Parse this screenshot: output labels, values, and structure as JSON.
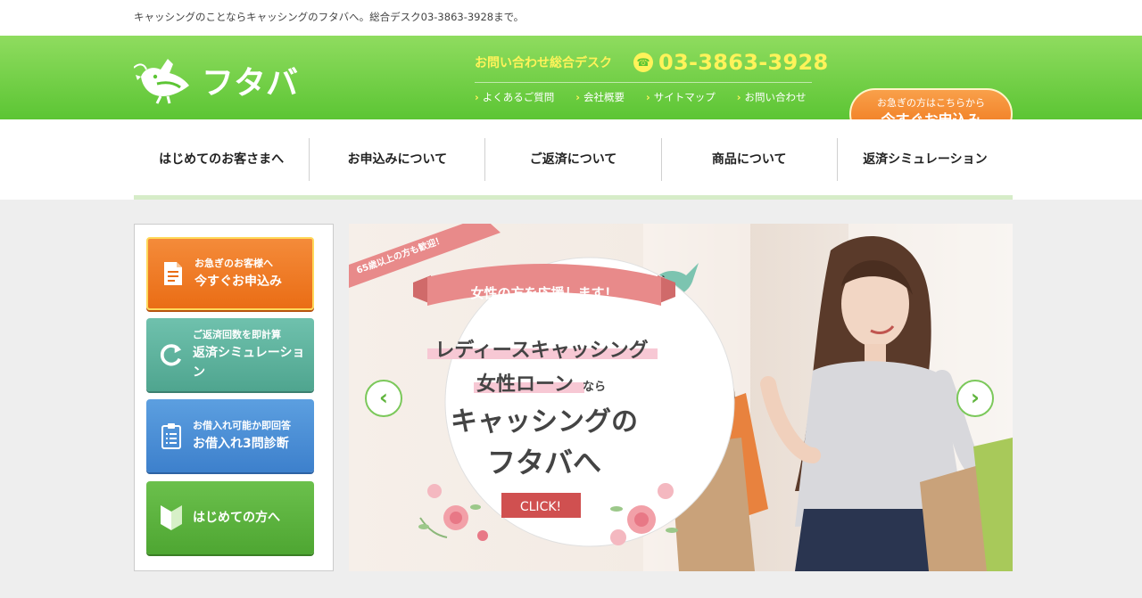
{
  "topbar": {
    "text": "キャッシングのことならキャッシングのフタバへ。総合デスク03-3863-3928まで。"
  },
  "header": {
    "logo_text": "フタバ",
    "contact_label": "お問い合わせ総合デスク",
    "phone": "03-3863-3928",
    "links": [
      "よくあるご質問",
      "会社概要",
      "サイトマップ",
      "お問い合わせ"
    ],
    "apply_small": "お急ぎの方はこちらから",
    "apply_big": "今すぐお申込み"
  },
  "nav": {
    "items": [
      "はじめてのお客さまへ",
      "お申込みについて",
      "ご返済について",
      "商品について",
      "返済シミュレーション"
    ]
  },
  "sidebar": {
    "buttons": [
      {
        "small": "お急ぎのお客様へ",
        "big": "今すぐお申込み",
        "icon": "document-icon"
      },
      {
        "small": "ご返済回数を即計算",
        "big": "返済シミュレーション",
        "icon": "refresh-icon"
      },
      {
        "small": "お借入れ可能か即回答",
        "big": "お借入れ3問診断",
        "icon": "clipboard-icon"
      },
      {
        "small": "",
        "big": "はじめての方へ",
        "icon": "beginner-mark-icon"
      }
    ]
  },
  "banner": {
    "ribbon": "65歳以上の方も歓迎！",
    "pink_banner": "女性の方を応援します！",
    "line1": "レディースキャッシング",
    "line2_main": "女性ローン",
    "line2_suffix": "なら",
    "line3": "キャッシングの",
    "line4": "フタバへ",
    "click": "CLICK!",
    "prev_arrow": "‹",
    "next_arrow": "›"
  },
  "colors": {
    "header_green": "#5cc534",
    "accent_yellow": "#fff35a",
    "orange": "#ee7418",
    "teal": "#4fa58f",
    "blue": "#3d80cc",
    "pink": "#e87a7a",
    "click_red": "#d05050"
  }
}
